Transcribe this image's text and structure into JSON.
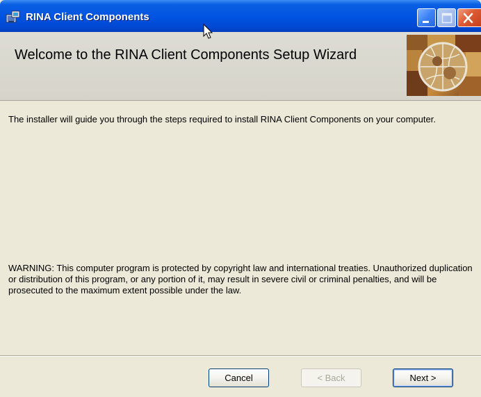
{
  "window": {
    "title": "RINA Client Components",
    "icon": "installer-package-icon"
  },
  "title_buttons": {
    "minimize_icon": "minimize-icon",
    "maximize_icon": "maximize-icon",
    "close_icon": "close-icon"
  },
  "header": {
    "title": "Welcome to the RINA Client Components Setup Wizard",
    "banner_image": "globe-collage-banner"
  },
  "body": {
    "intro": "The installer will guide you through the steps required to install RINA Client Components on your computer.",
    "warning": "WARNING: This computer program is protected by copyright law and international treaties. Unauthorized duplication or distribution of this program, or any portion of it, may result in severe civil or criminal penalties, and will be prosecuted to the maximum extent possible under the law."
  },
  "buttons": {
    "cancel": "Cancel",
    "back": "< Back",
    "next": "Next >"
  },
  "colors": {
    "titlebar": "#0053e0",
    "dialog_bg": "#ece9d8",
    "header_bg": "#d9d7ce",
    "close_button": "#dd5c34"
  }
}
